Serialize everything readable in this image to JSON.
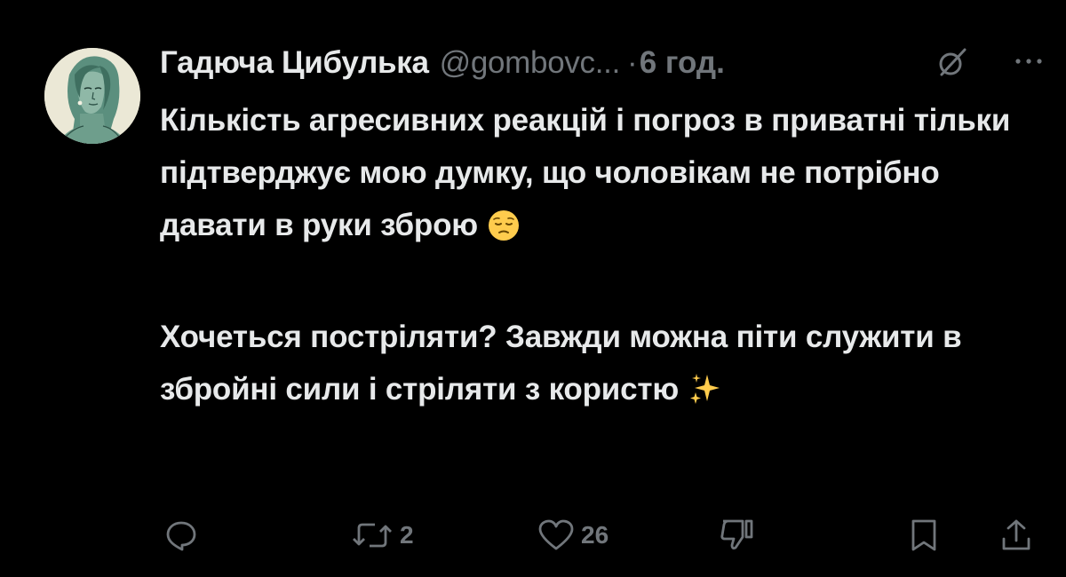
{
  "author": {
    "name": "Гадюча Цибулька",
    "handle": "@gombovc...",
    "separator": "·",
    "time": "6 год."
  },
  "icons": {
    "avatar": "avatar-illustration",
    "grok": "grok-icon",
    "more": "more-dots-icon",
    "reply": "speech-bubble-icon",
    "retweet": "retweet-icon",
    "like": "heart-icon",
    "dislike": "thumbs-down-icon",
    "bookmark": "bookmark-icon",
    "share": "share-icon",
    "emoji_pensive": "pensive-face-emoji",
    "emoji_sparkles": "sparkles-emoji"
  },
  "tweet": {
    "paragraph1": "Кількість агресивних реакцій і погроз в приватні тільки підтверджує мою думку, що чоловікам не потрібно давати в руки зброю",
    "paragraph2": "Хочеться постріляти? Завжди можна піти служити в збройні сили і стріляти з користю"
  },
  "stats": {
    "retweets": "2",
    "likes": "26"
  },
  "colors": {
    "background": "#000000",
    "text": "#e7e9ea",
    "muted": "#71767b",
    "avatar_bg": "#ebe8d6",
    "avatar_figure": "#5b8f7e"
  }
}
